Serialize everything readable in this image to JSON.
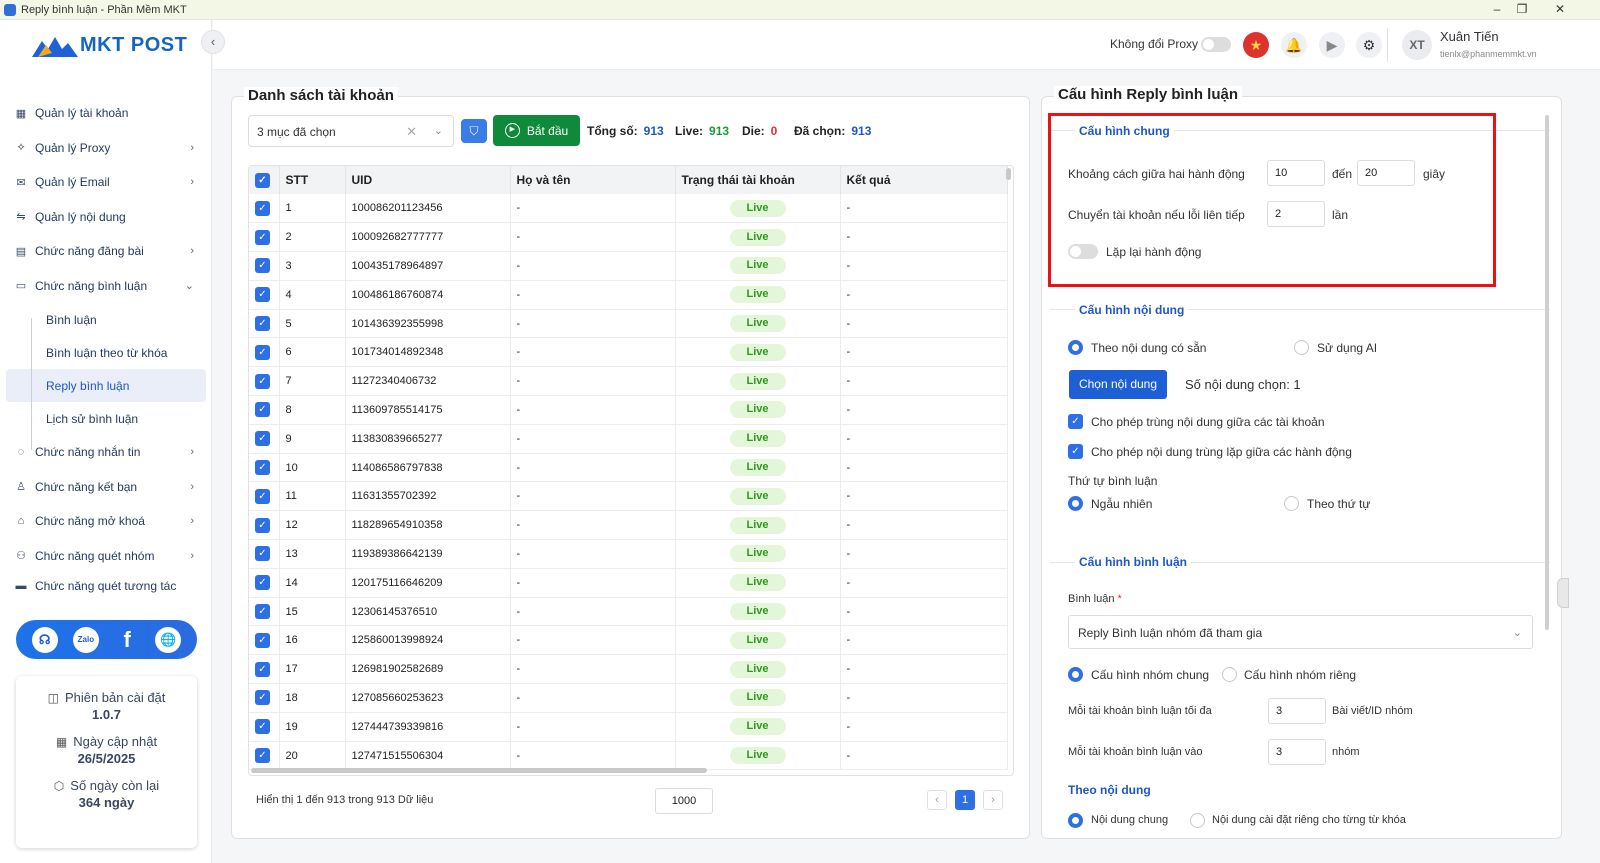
{
  "window": {
    "title": "Reply bình luận - Phần Mềm MKT",
    "minimize": "–",
    "restore": "❐",
    "close": "✕"
  },
  "logo": {
    "text": "MKT POST"
  },
  "sidebar": {
    "items": [
      {
        "label": "Quản lý tài khoản",
        "icon": "grid-icon",
        "chevron": ""
      },
      {
        "label": "Quản lý Proxy",
        "icon": "layers-icon",
        "chevron": "›"
      },
      {
        "label": "Quản lý Email",
        "icon": "mail-icon",
        "chevron": "›"
      },
      {
        "label": "Quản lý nội dung",
        "icon": "content-icon",
        "chevron": ""
      },
      {
        "label": "Chức năng đăng bài",
        "icon": "post-icon",
        "chevron": "›"
      },
      {
        "label": "Chức năng bình luận",
        "icon": "comment-icon",
        "chevron": "⌄"
      }
    ],
    "subitems": [
      {
        "label": "Bình luận"
      },
      {
        "label": "Bình luận theo từ khóa"
      },
      {
        "label": "Reply bình luận",
        "active": true
      },
      {
        "label": "Lịch sử bình luận"
      }
    ],
    "items2": [
      {
        "label": "Chức năng nhắn tin",
        "icon": "chat-icon",
        "chevron": "›"
      },
      {
        "label": "Chức năng kết bạn",
        "icon": "add-friend-icon",
        "chevron": "›"
      },
      {
        "label": "Chức năng mở khoá",
        "icon": "unlock-icon",
        "chevron": "›"
      },
      {
        "label": "Chức năng quét nhóm",
        "icon": "group-icon",
        "chevron": "›"
      },
      {
        "label": "Chức năng quét tương tác",
        "icon": "scan-icon",
        "chevron": ""
      }
    ],
    "info": {
      "version_label": "Phiên bản cài đặt",
      "version": "1.0.7",
      "update_label": "Ngày cập nhật",
      "update": "26/5/2025",
      "days_label": "Số ngày còn lại",
      "days": "364 ngày"
    }
  },
  "topbar": {
    "proxy_label": "Không đổi Proxy",
    "avatar": "XT",
    "user_name": "Xuân Tiến",
    "user_email": "tienlx@phanmemmkt.vn"
  },
  "accounts": {
    "title": "Danh sách tài khoản",
    "select_value": "3 mục đã chọn",
    "start_button": "Bắt đầu",
    "stats": {
      "total_label": "Tổng số:",
      "total": "913",
      "live_label": "Live:",
      "live": "913",
      "die_label": "Die:",
      "die": "0",
      "selected_label": "Đã chọn:",
      "selected": "913"
    },
    "columns": [
      "STT",
      "UID",
      "Họ và tên",
      "Trạng thái tài khoản",
      "Kết quả"
    ],
    "rows": [
      {
        "stt": "1",
        "uid": "100086201123456",
        "name": "-",
        "status": "Live",
        "result": "-"
      },
      {
        "stt": "2",
        "uid": "100092682777777",
        "name": "-",
        "status": "Live",
        "result": "-"
      },
      {
        "stt": "3",
        "uid": "100435178964897",
        "name": "-",
        "status": "Live",
        "result": "-"
      },
      {
        "stt": "4",
        "uid": "100486186760874",
        "name": "-",
        "status": "Live",
        "result": "-"
      },
      {
        "stt": "5",
        "uid": "101436392355998",
        "name": "-",
        "status": "Live",
        "result": "-"
      },
      {
        "stt": "6",
        "uid": "101734014892348",
        "name": "-",
        "status": "Live",
        "result": "-"
      },
      {
        "stt": "7",
        "uid": "11272340406732",
        "name": "-",
        "status": "Live",
        "result": "-"
      },
      {
        "stt": "8",
        "uid": "113609785514175",
        "name": "-",
        "status": "Live",
        "result": "-"
      },
      {
        "stt": "9",
        "uid": "113830839665277",
        "name": "-",
        "status": "Live",
        "result": "-"
      },
      {
        "stt": "10",
        "uid": "114086586797838",
        "name": "-",
        "status": "Live",
        "result": "-"
      },
      {
        "stt": "11",
        "uid": "11631355702392",
        "name": "-",
        "status": "Live",
        "result": "-"
      },
      {
        "stt": "12",
        "uid": "118289654910358",
        "name": "-",
        "status": "Live",
        "result": "-"
      },
      {
        "stt": "13",
        "uid": "119389386642139",
        "name": "-",
        "status": "Live",
        "result": "-"
      },
      {
        "stt": "14",
        "uid": "120175116646209",
        "name": "-",
        "status": "Live",
        "result": "-"
      },
      {
        "stt": "15",
        "uid": "12306145376510",
        "name": "-",
        "status": "Live",
        "result": "-"
      },
      {
        "stt": "16",
        "uid": "125860013998924",
        "name": "-",
        "status": "Live",
        "result": "-"
      },
      {
        "stt": "17",
        "uid": "126981902582689",
        "name": "-",
        "status": "Live",
        "result": "-"
      },
      {
        "stt": "18",
        "uid": "127085660253623",
        "name": "-",
        "status": "Live",
        "result": "-"
      },
      {
        "stt": "19",
        "uid": "127444739339816",
        "name": "-",
        "status": "Live",
        "result": "-"
      },
      {
        "stt": "20",
        "uid": "127471515506304",
        "name": "-",
        "status": "Live",
        "result": "-"
      }
    ],
    "footer": "Hiển thị 1 đến 913 trong 913 Dữ liệu",
    "page_size": "1000",
    "page": "1"
  },
  "config": {
    "title": "Cấu hình Reply bình luận",
    "general": {
      "title": "Cấu hình chung",
      "delay_label": "Khoảng cách giữa hai hành động",
      "delay_from": "10",
      "to_label": "đến",
      "delay_to": "20",
      "unit": "giây",
      "switch_label": "Chuyển tài khoản nếu lỗi liên tiếp",
      "switch_value": "2",
      "switch_unit": "lần",
      "repeat_label": "Lặp lại hành động"
    },
    "content": {
      "title": "Cấu hình nội dung",
      "opt1": "Theo nội dung có sẵn",
      "opt2": "Sử dụng AI",
      "choose_button": "Chọn nội dung",
      "chosen_count": "Số nội dung chọn: 1",
      "chk1": "Cho phép trùng nội dung giữa các tài khoản",
      "chk2": "Cho phép nội dung trùng lặp giữa các hành động",
      "order_label": "Thứ tự bình luận",
      "order1": "Ngẫu nhiên",
      "order2": "Theo thứ tự"
    },
    "comment": {
      "title": "Cấu hình bình luận",
      "field_label": "Bình luận",
      "required": "*",
      "field_value": "Reply Bình luận nhóm đã tham gia",
      "grp1": "Cấu hình nhóm chung",
      "grp2": "Cấu hình nhóm riêng",
      "max_label": "Mỗi tài khoản bình luận tối đa",
      "max_value": "3",
      "max_unit": "Bài viết/ID nhóm",
      "into_label": "Mỗi tài khoản bình luận vào",
      "into_value": "3",
      "into_unit": "nhóm",
      "by_content": "Theo nội dung",
      "cc1": "Nội dung chung",
      "cc2": "Nội dung cài đặt riêng cho từng từ khóa"
    }
  }
}
